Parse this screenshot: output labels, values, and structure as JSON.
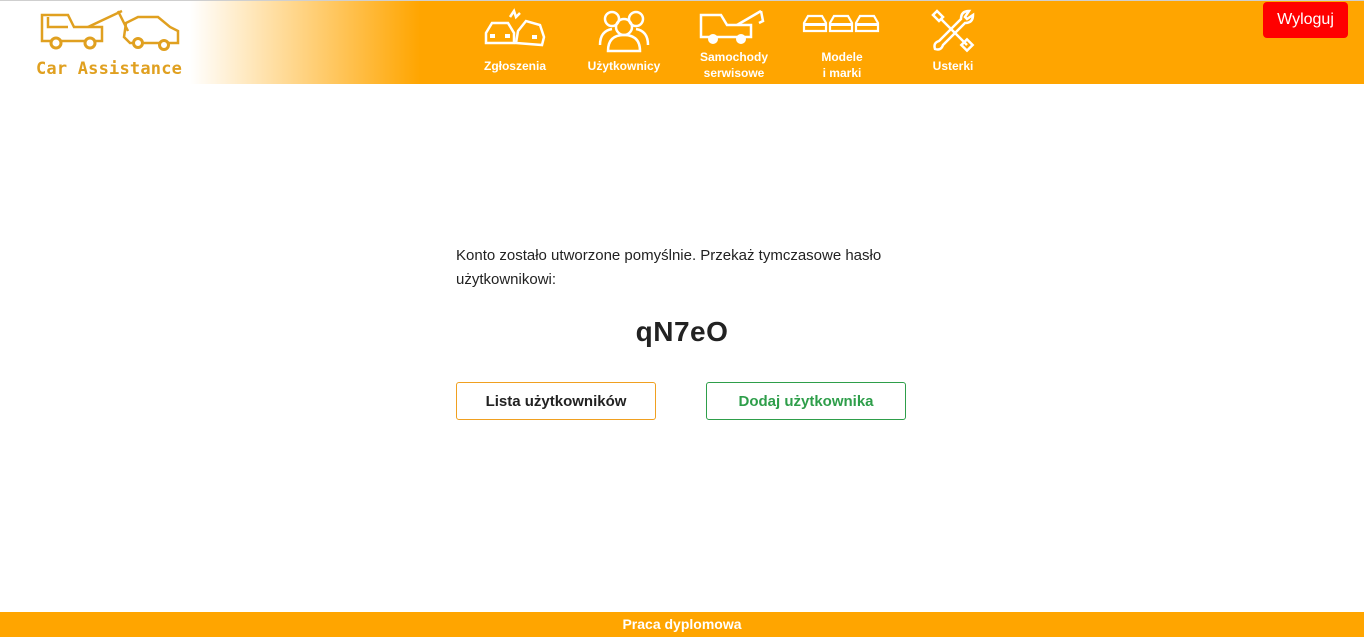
{
  "header": {
    "brand": "Car Assistance",
    "logout_label": "Wyloguj",
    "colors": {
      "bar": "#ffa500",
      "logout": "#ff0000",
      "brand": "#e0a020"
    },
    "nav": [
      {
        "label": "Zgłoszenia",
        "icon": "car-crash-icon"
      },
      {
        "label": "Użytkownicy",
        "icon": "users-icon"
      },
      {
        "label": "Samochody\nserwisowe",
        "icon": "tow-truck-icon"
      },
      {
        "label": "Modele\ni marki",
        "icon": "cars-icon"
      },
      {
        "label": "Usterki",
        "icon": "tools-icon"
      }
    ]
  },
  "main": {
    "message": "Konto zostało utworzone pomyślnie. Przekaż tymczasowe hasło użytkownikowi:",
    "temp_password": "qN7eO",
    "list_button": "Lista użytkowników",
    "add_button": "Dodaj użytkownika"
  },
  "footer": {
    "text": "Praca dyplomowa"
  }
}
